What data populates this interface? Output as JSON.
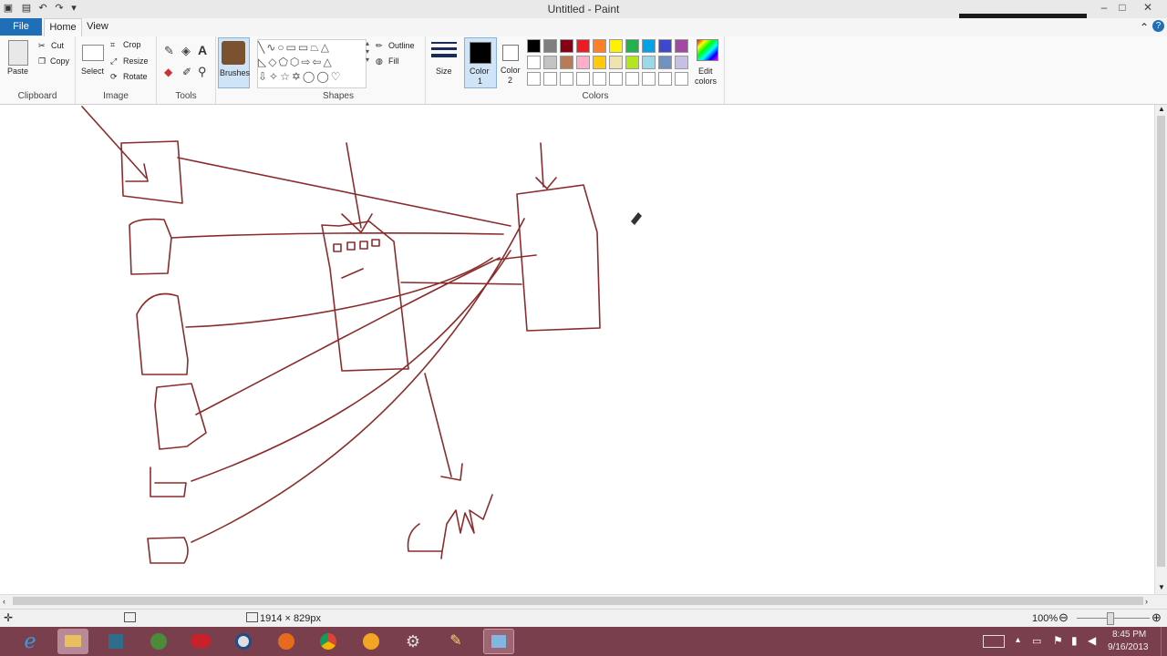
{
  "window": {
    "title": "Untitled - Paint",
    "controls": [
      "–",
      "□",
      "✕"
    ]
  },
  "tabs": {
    "file": "File",
    "home": "Home",
    "view": "View"
  },
  "ribbon": {
    "clipboard": {
      "label": "Clipboard",
      "paste": "Paste",
      "cut": "Cut",
      "copy": "Copy"
    },
    "image": {
      "label": "Image",
      "select": "Select",
      "crop": "Crop",
      "resize": "Resize",
      "rotate": "Rotate"
    },
    "tools": {
      "label": "Tools"
    },
    "brushes": {
      "label": "Brushes"
    },
    "shapes": {
      "label": "Shapes",
      "outline": "Outline",
      "fill": "Fill"
    },
    "size": {
      "label": "Size"
    },
    "color1": {
      "label": "Color",
      "num": "1"
    },
    "color2": {
      "label": "Color",
      "num": "2"
    },
    "colors": {
      "label": "Colors",
      "edit1": "Edit",
      "edit2": "colors"
    },
    "palette_row1": [
      "#000000",
      "#7f7f7f",
      "#880015",
      "#ed1c24",
      "#ff7f27",
      "#fff200",
      "#22b14c",
      "#00a2e8",
      "#3f48cc",
      "#a349a4"
    ],
    "palette_row2": [
      "#ffffff",
      "#c3c3c3",
      "#b97a57",
      "#ffaec9",
      "#ffc90e",
      "#efe4b0",
      "#b5e61d",
      "#99d9ea",
      "#7092be",
      "#c8bfe7"
    ]
  },
  "status": {
    "dimensions": "1914 × 829px",
    "zoom": "100%"
  },
  "taskbar": {
    "time": "8:45 PM",
    "date": "9/16/2013"
  },
  "colors": {
    "file_tab": "#1e6fb7",
    "drawing_stroke": "#8b2c2c",
    "taskbar": "#7a3f4c"
  }
}
